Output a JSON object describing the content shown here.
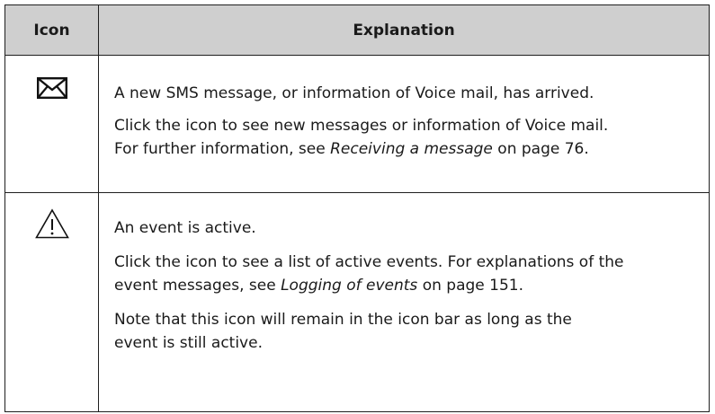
{
  "table": {
    "headers": {
      "icon": "Icon",
      "explanation": "Explanation"
    },
    "rows": [
      {
        "icon": "envelope-icon",
        "paragraphs": [
          {
            "text": "A new SMS message, or information of Voice mail, has arrived."
          },
          {
            "lines": [
              {
                "pre": "Click the icon to see new messages or information of Voice mail."
              },
              {
                "pre": "For further information, see ",
                "ref": "Receiving a message",
                "post": " on page 76."
              }
            ]
          }
        ]
      },
      {
        "icon": "warning-triangle-icon",
        "paragraphs": [
          {
            "text": "An event is active."
          },
          {
            "lines": [
              {
                "pre": "Click the icon to see a list of active events. For explanations of the"
              },
              {
                "pre": "event messages, see ",
                "ref": "Logging of events",
                "post": " on page 151."
              }
            ]
          },
          {
            "lines": [
              {
                "pre": "Note that this icon will remain in the icon bar as long as the"
              },
              {
                "pre": "event is still active."
              }
            ]
          }
        ]
      }
    ]
  }
}
